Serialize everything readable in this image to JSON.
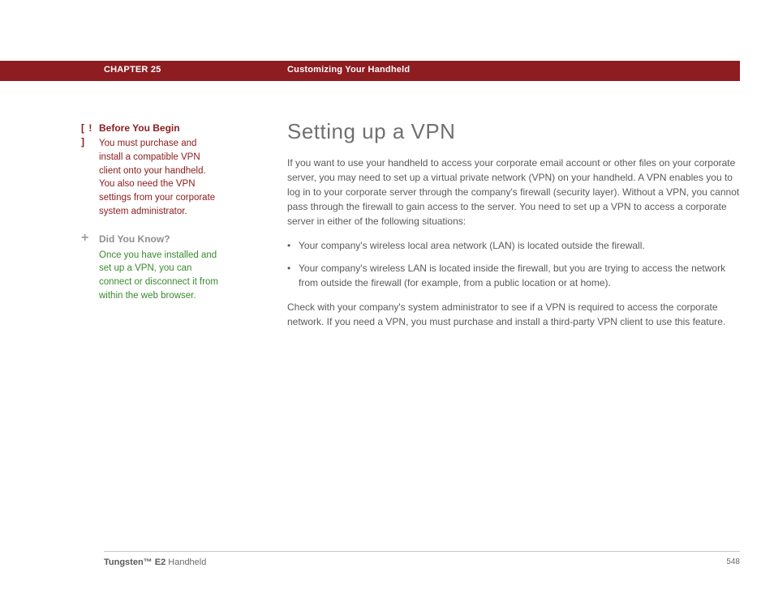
{
  "header": {
    "chapter": "CHAPTER 25",
    "title": "Customizing Your Handheld"
  },
  "sidebar": {
    "before": {
      "icon": "[ ! ]",
      "heading": "Before You Begin",
      "body": "You must purchase and install a compatible VPN client onto your handheld. You also need the VPN settings from your corporate system administrator."
    },
    "dyk": {
      "icon": "+",
      "heading": "Did You Know?",
      "body": "Once you have installed and set up a VPN, you can connect or disconnect it from within the web browser."
    }
  },
  "main": {
    "heading": "Setting up a VPN",
    "intro": "If you want to use your handheld to access your corporate email account or other files on your corporate server, you may need to set up a virtual private network (VPN) on your handheld. A VPN enables you to log in to your corporate server through the company's firewall (security layer). Without a VPN, you cannot pass through the firewall to gain access to the server. You need to set up a VPN to access a corporate server in either of the following situations:",
    "bullets": [
      "Your company's wireless local area network (LAN) is located outside the firewall.",
      "Your company's wireless LAN is located inside the firewall, but you are trying to access the network from outside the firewall (for example, from a public location or at home)."
    ],
    "outro": "Check with your company's system administrator to see if a VPN is required to access the corporate network. If you need a VPN, you must purchase and install a third-party VPN client to use this feature."
  },
  "footer": {
    "product_bold": "Tungsten™ E2",
    "product_rest": " Handheld",
    "page": "548"
  }
}
